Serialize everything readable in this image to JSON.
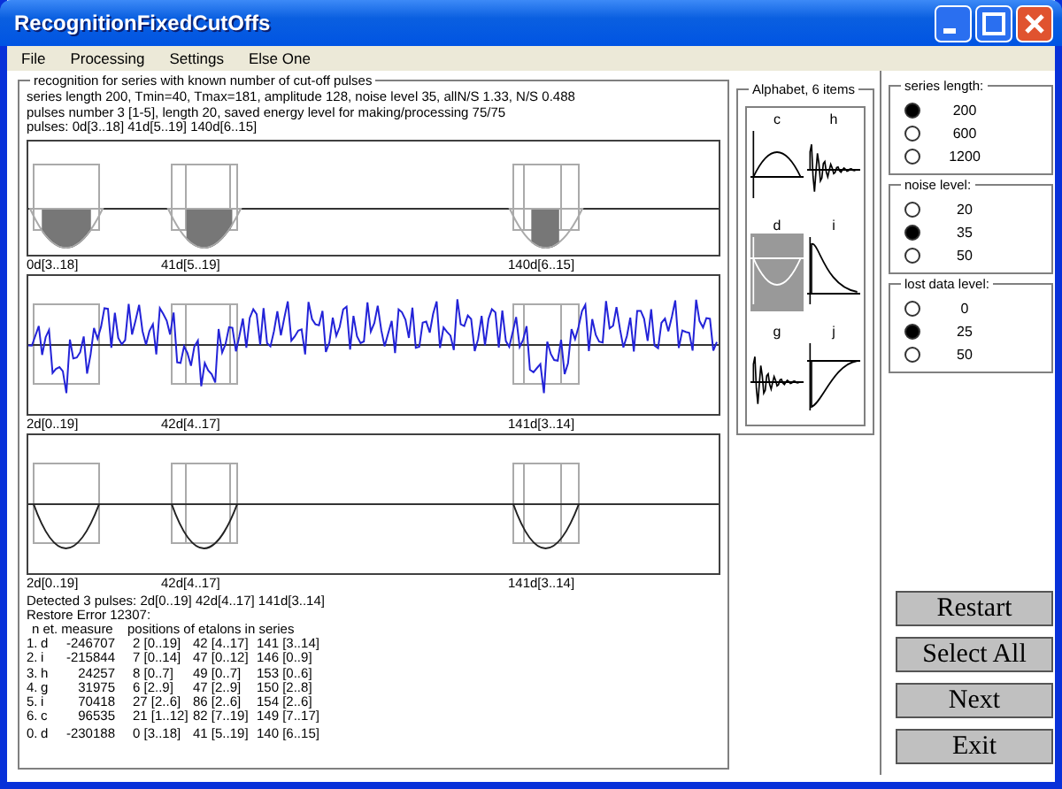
{
  "window": {
    "title": "RecognitionFixedCutOffs"
  },
  "menu": [
    "File",
    "Processing",
    "Settings",
    "Else One"
  ],
  "recognition": {
    "legend": "recognition for series with known number of cut-off pulses",
    "info_lines": [
      "series length 200, Tmin=40, Tmax=181,  amplitude 128, noise level 35, allN/S 1.33,  N/S 0.488",
      "pulses number 3 [1-5], length 20, saved energy level for making/processing 75/75",
      "pulses: 0d[3..18]  41d[5..19]  140d[6..15]"
    ],
    "plots": [
      {
        "kind": "cutoff",
        "labels": [
          "0d[3..18]",
          "41d[5..19]",
          "140d[6..15]"
        ]
      },
      {
        "kind": "signal",
        "labels": [
          "2d[0..19]",
          "42d[4..17]",
          "141d[3..14]"
        ]
      },
      {
        "kind": "restored",
        "labels": [
          "2d[0..19]",
          "42d[4..17]",
          "141d[3..14]"
        ]
      }
    ],
    "detected": "Detected 3 pulses:  2d[0..19] 42d[4..17] 141d[3..14]",
    "restore_error": "Restore Error 12307:",
    "table": {
      "columns": [
        "n et. measure",
        "positions of etalons in series"
      ],
      "rows": [
        {
          "n": "1.",
          "et": "d",
          "measure": "-246707",
          "positions": [
            "2 [0..19]",
            "42 [4..17]",
            "141 [3..14]"
          ]
        },
        {
          "n": "2.",
          "et": "i",
          "measure": "-215844",
          "positions": [
            "7 [0..14]",
            "47 [0..12]",
            "146 [0..9]"
          ]
        },
        {
          "n": "3.",
          "et": "h",
          "measure": "24257",
          "positions": [
            "8 [0..7]",
            "49 [0..7]",
            "153 [0..6]"
          ]
        },
        {
          "n": "4.",
          "et": "g",
          "measure": "31975",
          "positions": [
            "6 [2..9]",
            "47 [2..9]",
            "150 [2..8]"
          ]
        },
        {
          "n": "5.",
          "et": "i",
          "measure": "70418",
          "positions": [
            "27 [2..6]",
            "86 [2..6]",
            "154 [2..6]"
          ]
        },
        {
          "n": "6.",
          "et": "c",
          "measure": "96535",
          "positions": [
            "21 [1..12]",
            "82 [7..19]",
            "149 [7..17]"
          ]
        },
        {
          "n": "0.",
          "et": "d",
          "measure": "-230188",
          "positions": [
            "0 [3..18]",
            "41 [5..19]",
            "140 [6..15]"
          ]
        }
      ]
    }
  },
  "alphabet": {
    "legend": "Alphabet, 6 items",
    "items": [
      {
        "label": "c",
        "kind": "hump",
        "selected": false
      },
      {
        "label": "h",
        "kind": "oscillation",
        "selected": false
      },
      {
        "label": "d",
        "kind": "bowl",
        "selected": true
      },
      {
        "label": "i",
        "kind": "decay",
        "selected": false
      },
      {
        "label": "g",
        "kind": "oscillation",
        "selected": false
      },
      {
        "label": "j",
        "kind": "dip",
        "selected": false
      }
    ]
  },
  "settings": [
    {
      "legend": "series length:",
      "options": [
        {
          "label": "200",
          "selected": true
        },
        {
          "label": "600",
          "selected": false
        },
        {
          "label": "1200",
          "selected": false
        }
      ]
    },
    {
      "legend": "noise level:",
      "options": [
        {
          "label": "20",
          "selected": false
        },
        {
          "label": "35",
          "selected": true
        },
        {
          "label": "50",
          "selected": false
        }
      ]
    },
    {
      "legend": "lost data level:",
      "options": [
        {
          "label": "0",
          "selected": false
        },
        {
          "label": "25",
          "selected": true
        },
        {
          "label": "50",
          "selected": false
        }
      ]
    }
  ],
  "buttons": [
    "Restart",
    "Select All",
    "Next",
    "Exit"
  ]
}
